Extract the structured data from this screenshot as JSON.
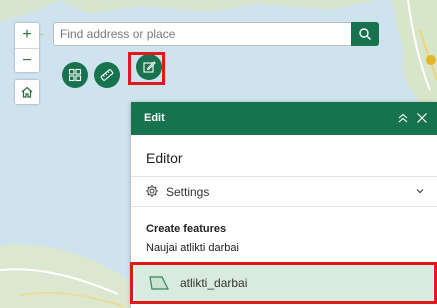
{
  "search": {
    "placeholder": "Find address or place"
  },
  "map_controls": {
    "zoom_in_label": "+",
    "zoom_out_label": "−"
  },
  "edit_panel": {
    "header_title": "Edit",
    "editor_title": "Editor",
    "settings_label": "Settings",
    "create_features_label": "Create features",
    "layer_name": "Naujai atlikti darbai",
    "templates": [
      {
        "label": "atlikti_darbai"
      }
    ]
  },
  "colors": {
    "accent": "#17734d",
    "highlight": "#e0191b",
    "selected_bg": "#d8ebde",
    "water": "#cfe3ef",
    "land": "#d9e6cf"
  },
  "icons": {
    "search": "search-icon",
    "home": "home-icon",
    "basemap": "basemap-gallery-icon",
    "measure": "measure-icon",
    "edit": "edit-icon",
    "collapse": "collapse-icon",
    "close": "close-icon",
    "settings": "gear-icon",
    "chevron": "chevron-down-icon",
    "template": "polygon-template-icon"
  }
}
